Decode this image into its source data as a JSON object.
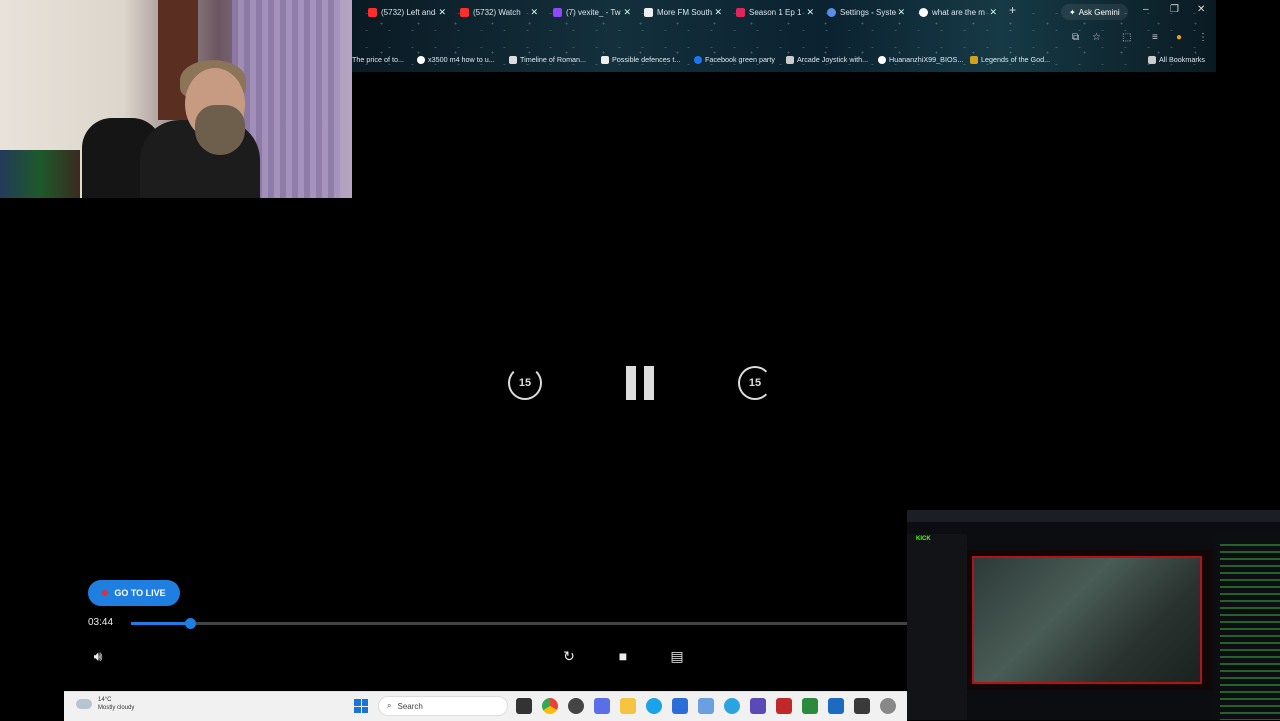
{
  "browser": {
    "tabs": [
      {
        "label": "(5732) Left and",
        "color": "#ff2d2d"
      },
      {
        "label": "(5732) Watch",
        "color": "#ff2d2d"
      },
      {
        "label": "(7) vexite_ - Tw",
        "color": "#9146ff"
      },
      {
        "label": "More FM South",
        "color": "#ffffff"
      },
      {
        "label": "Season 1 Ep 1",
        "color": "#e0245e"
      },
      {
        "label": "Settings - Syste",
        "color": "#5a8de8"
      },
      {
        "label": "what are the m",
        "color": "#ffffff"
      }
    ],
    "new_tab": "+",
    "ask_gemini": "Ask Gemini",
    "bookmarks": [
      {
        "label": "The price of to...",
        "color": "#888888"
      },
      {
        "label": "x3500 m4 how to u...",
        "color": "#ffffff"
      },
      {
        "label": "Timeline of Roman...",
        "color": "#dddddd"
      },
      {
        "label": "Possible defences t...",
        "color": "#eeeeee"
      },
      {
        "label": "Facebook green party",
        "color": "#1877f2"
      },
      {
        "label": "Arcade Joystick with...",
        "color": "#cccccc"
      },
      {
        "label": "HuananzhiX99_BIOS...",
        "color": "#ffffff"
      },
      {
        "label": "Legends of the God...",
        "color": "#d4a020"
      }
    ],
    "all_bookmarks": "All Bookmarks"
  },
  "player": {
    "skip_back": "15",
    "skip_forward": "15",
    "go_live": "GO TO LIVE",
    "time": "03:44",
    "progress": 0.076
  },
  "taskbar": {
    "temp": "14°C",
    "weather": "Mostly cloudy",
    "search_placeholder": "Search"
  },
  "pip": {
    "site": "KICK"
  },
  "colors": {
    "accent": "#1f7fe0",
    "live_dot": "#e03030"
  }
}
